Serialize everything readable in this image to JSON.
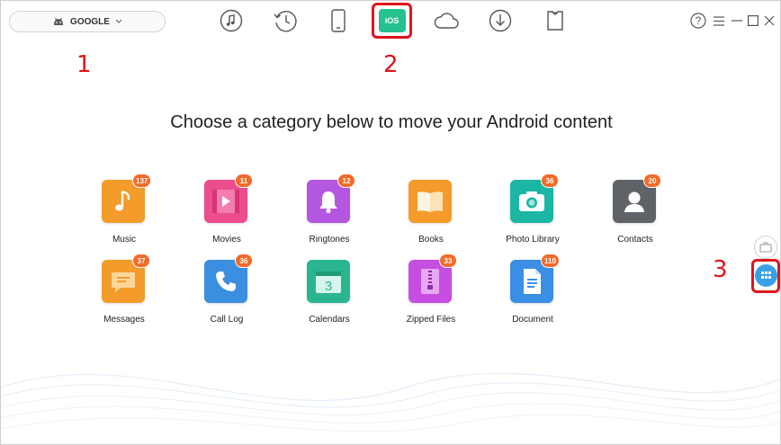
{
  "device": {
    "name": "GOOGLE"
  },
  "toolbar": {
    "items": [
      {
        "name": "music-manager",
        "icon": "music-note-icon"
      },
      {
        "name": "backup-history",
        "icon": "history-icon"
      },
      {
        "name": "device-manager",
        "icon": "phone-icon"
      },
      {
        "name": "android-to-ios",
        "icon": "ios-transfer-icon",
        "label": "iOS"
      },
      {
        "name": "cloud-manager",
        "icon": "cloud-icon"
      },
      {
        "name": "downloader",
        "icon": "download-icon"
      },
      {
        "name": "toolkit",
        "icon": "shirt-icon"
      }
    ]
  },
  "window": {
    "help": "?"
  },
  "annotations": {
    "a1": "1",
    "a2": "2",
    "a3": "3"
  },
  "main": {
    "heading": "Choose a category below to move your Android content"
  },
  "categories": [
    {
      "label": "Music",
      "count": "137",
      "color": "#f39b2b"
    },
    {
      "label": "Movies",
      "count": "11",
      "color": "#ec4d8c"
    },
    {
      "label": "Ringtones",
      "count": "12",
      "color": "#b356e0"
    },
    {
      "label": "Books",
      "count": "",
      "color": "#f59b2b"
    },
    {
      "label": "Photo Library",
      "count": "36",
      "color": "#1bb6a4"
    },
    {
      "label": "Contacts",
      "count": "20",
      "color": "#5f6368"
    },
    {
      "label": "Messages",
      "count": "37",
      "color": "#f39b2b"
    },
    {
      "label": "Call Log",
      "count": "36",
      "color": "#3b8fe0"
    },
    {
      "label": "Calendars",
      "count": "",
      "color": "#2ab590"
    },
    {
      "label": "Zipped Files",
      "count": "33",
      "color": "#c64ee0"
    },
    {
      "label": "Document",
      "count": "110",
      "color": "#3a8ee6"
    }
  ],
  "colors": {
    "accent": "#25c18f",
    "highlight": "#e0141b",
    "badge": "#f26b2a",
    "side": "#3aa0e6"
  }
}
